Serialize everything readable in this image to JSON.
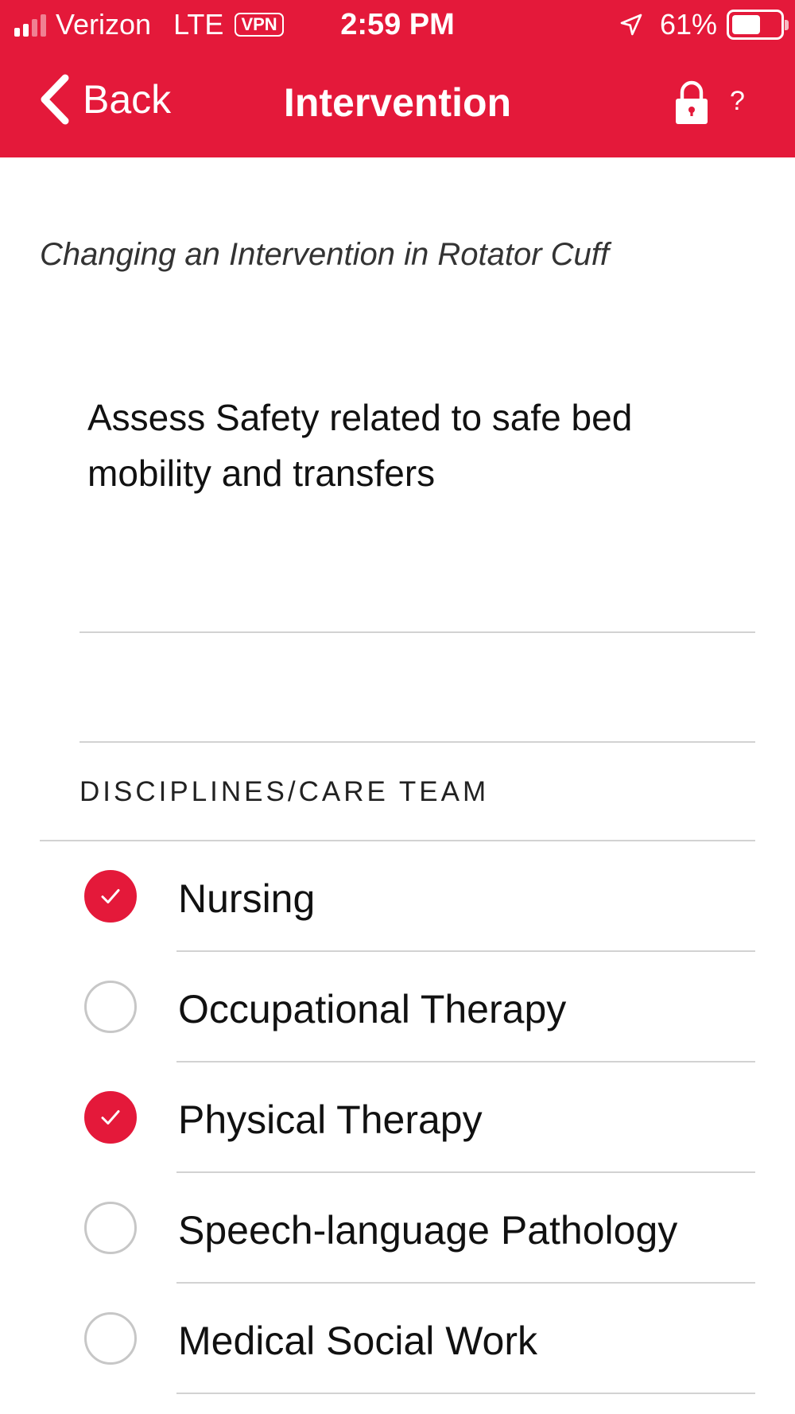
{
  "status_bar": {
    "carrier": "Verizon",
    "network": "LTE",
    "vpn": "VPN",
    "time": "2:59 PM",
    "battery": "61%",
    "battery_level": 0.61,
    "signal_bars": 2
  },
  "navbar": {
    "back_label": "Back",
    "title": "Intervention",
    "help_label": "?",
    "icons": [
      "back-chevron-icon",
      "lock-icon"
    ]
  },
  "content": {
    "subtitle": "Changing an Intervention in Rotator Cuff",
    "intervention_text": "Assess Safety related to safe bed mobility and transfers"
  },
  "disciplines": {
    "header": "DISCIPLINES/CARE TEAM",
    "items": [
      {
        "label": "Nursing",
        "checked": true
      },
      {
        "label": "Occupational Therapy",
        "checked": false
      },
      {
        "label": "Physical Therapy",
        "checked": true
      },
      {
        "label": "Speech-language Pathology",
        "checked": false
      },
      {
        "label": "Medical Social Work",
        "checked": false
      }
    ]
  },
  "colors": {
    "accent": "#e4193a",
    "separator": "#d2d2d2",
    "unchecked_border": "#c7c7c7"
  }
}
